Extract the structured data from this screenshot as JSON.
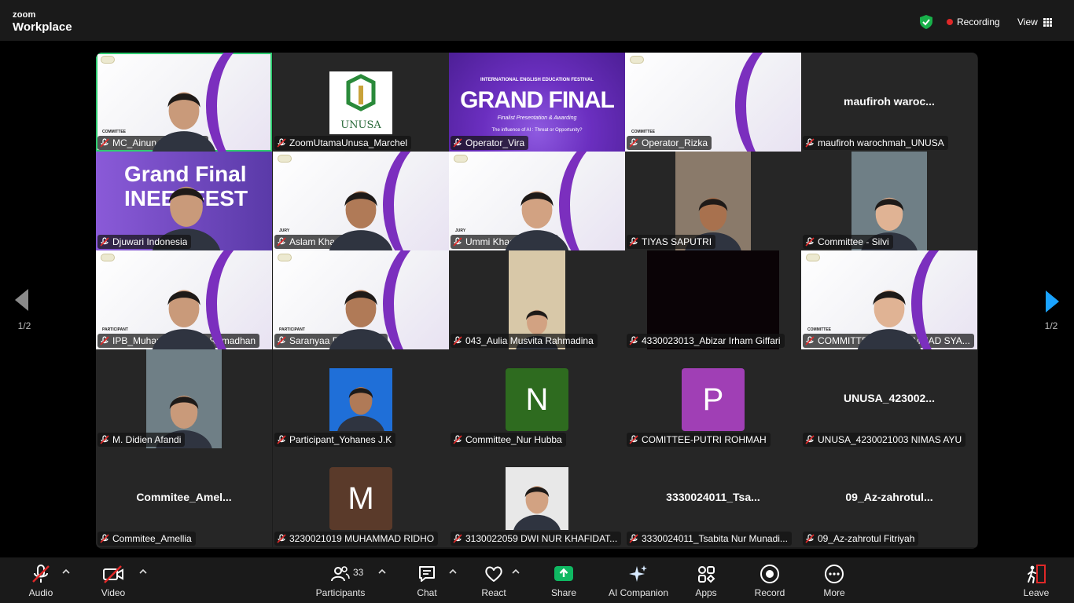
{
  "app": {
    "brand_top": "zoom",
    "brand_bottom": "Workplace"
  },
  "header": {
    "recording_label": "Recording",
    "view_label": "View"
  },
  "pager": {
    "left": "1/2",
    "right": "1/2"
  },
  "tiles": [
    {
      "name": "MC_Ainun Rayyan. M",
      "kind": "video",
      "role": "COMMITTEE",
      "active": true
    },
    {
      "name": "ZoomUtamaUnusa_Marchel",
      "kind": "logo",
      "logo_text": "UNUSA"
    },
    {
      "name": "Operator_Vira",
      "kind": "poster",
      "poster_top": "INTERNATIONAL ENGLISH EDUCATION FESTIVAL",
      "poster_title": "GRAND FINAL",
      "poster_sub": "Finalist Presentation & Awarding",
      "poster_q": "The influence of AI : Threat or Opportunity?"
    },
    {
      "name": "Operator_Rizka",
      "kind": "background",
      "role": "COMMITTEE"
    },
    {
      "name": "maufiroh warochmah_UNUSA",
      "kind": "text",
      "display": "maufiroh  waroc..."
    },
    {
      "name": "Djuwari Indonesia",
      "kind": "video",
      "overlay": "Grand Final INEEDFEST"
    },
    {
      "name": "Aslam Khan",
      "kind": "video",
      "role": "JURY"
    },
    {
      "name": "Ummi Khaerati Syam",
      "kind": "video",
      "role": "JURY"
    },
    {
      "name": "TIYAS SAPUTRI",
      "kind": "video"
    },
    {
      "name": "Committee - Silvi",
      "kind": "video"
    },
    {
      "name": "IPB_Muhammad Fajar Ramadhan",
      "kind": "video",
      "role": "PARTICIPANT"
    },
    {
      "name": "Saranyaa Prommanop",
      "kind": "video",
      "role": "PARTICIPANT"
    },
    {
      "name": "043_Aulia Musvita Rahmadina",
      "kind": "video"
    },
    {
      "name": "4330023013_Abizar Irham Giffari",
      "kind": "dark"
    },
    {
      "name": "COMMITTEE _ MUHAMMAD SYA...",
      "kind": "video",
      "role": "COMMITTEE"
    },
    {
      "name": "M. Didien Afandi",
      "kind": "video"
    },
    {
      "name": "Participant_Yohanes J.K",
      "kind": "photo"
    },
    {
      "name": "Committee_Nur Hubba",
      "kind": "avatar",
      "letter": "N",
      "color": "#2e6b1f"
    },
    {
      "name": "COMITTEE-PUTRI ROHMAH",
      "kind": "avatar",
      "letter": "P",
      "color": "#a03fb5"
    },
    {
      "name": "UNUSA_4230021003 NIMAS AYU",
      "kind": "text",
      "display": "UNUSA_423002..."
    },
    {
      "name": "Commitee_Amellia",
      "kind": "text",
      "display": "Commitee_Amel..."
    },
    {
      "name": "3230021019 MUHAMMAD RIDHO",
      "kind": "avatar",
      "letter": "M",
      "color": "#5a3a2a"
    },
    {
      "name": "3130022059 DWI NUR KHAFIDAT...",
      "kind": "photo"
    },
    {
      "name": "3330024011_Tsabita Nur Munadi...",
      "kind": "text",
      "display": "3330024011_Tsa..."
    },
    {
      "name": "09_Az-zahrotul Fitriyah",
      "kind": "text",
      "display": "09_Az-zahrotul..."
    }
  ],
  "toolbar": {
    "audio": "Audio",
    "video": "Video",
    "participants": "Participants",
    "participants_count": "33",
    "chat": "Chat",
    "react": "React",
    "share": "Share",
    "ai_companion": "AI Companion",
    "apps": "Apps",
    "record": "Record",
    "more": "More",
    "leave": "Leave"
  },
  "colors": {
    "active_border": "#2ecc71",
    "share_green": "#0fb862",
    "recording_red": "#e02828",
    "nav_blue": "#1aa3ff"
  }
}
